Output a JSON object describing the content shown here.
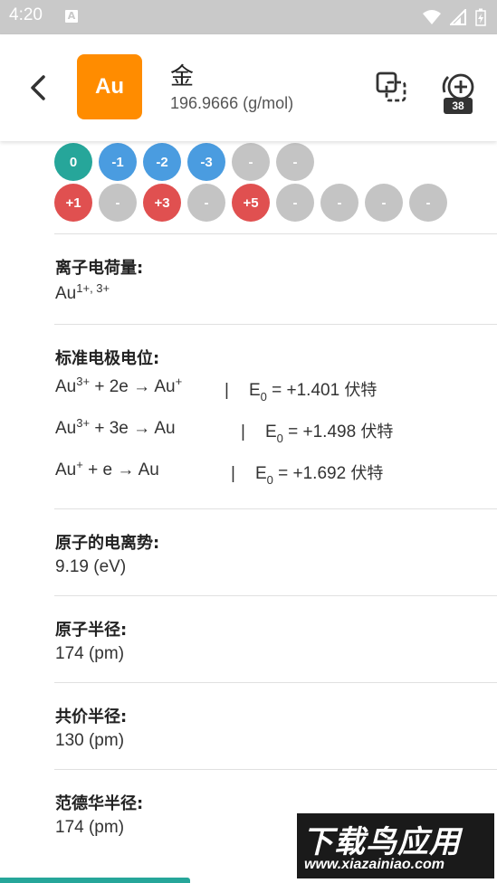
{
  "status_bar": {
    "time": "4:20",
    "notif_icon": "A"
  },
  "header": {
    "symbol": "Au",
    "name": "金",
    "molar_mass": "196.9666 (g/mol)",
    "counter": "38",
    "tile_color": "#ff8c00"
  },
  "oxidation_states": {
    "row1": [
      {
        "label": "0",
        "color": "#26a69a"
      },
      {
        "label": "-1",
        "color": "#4a9ce0"
      },
      {
        "label": "-2",
        "color": "#4a9ce0"
      },
      {
        "label": "-3",
        "color": "#4a9ce0"
      },
      {
        "label": "-",
        "color": "#c4c4c4"
      },
      {
        "label": "-",
        "color": "#c4c4c4"
      }
    ],
    "row2": [
      {
        "label": "+1",
        "color": "#e05050"
      },
      {
        "label": "-",
        "color": "#c4c4c4"
      },
      {
        "label": "+3",
        "color": "#e05050"
      },
      {
        "label": "-",
        "color": "#c4c4c4"
      },
      {
        "label": "+5",
        "color": "#e05050"
      },
      {
        "label": "-",
        "color": "#c4c4c4"
      },
      {
        "label": "-",
        "color": "#c4c4c4"
      },
      {
        "label": "-",
        "color": "#c4c4c4"
      },
      {
        "label": "-",
        "color": "#c4c4c4"
      }
    ]
  },
  "ion_charge": {
    "label": "离子电荷量:",
    "base": "Au",
    "sup": "1+, 3+"
  },
  "electrode": {
    "label": "标准电极电位:",
    "equations": [
      {
        "a": "Au",
        "a_sup": "3+",
        "mid": " + 2e → Au",
        "mid_sup": "+",
        "sep": "|",
        "e": "E",
        "e_sub": "0",
        "val": " = +1.401 ",
        "unit": "伏特"
      },
      {
        "a": "Au",
        "a_sup": "3+",
        "mid": " + 3e → Au",
        "mid_sup": "",
        "sep": "|",
        "e": "E",
        "e_sub": "0",
        "val": " = +1.498 ",
        "unit": "伏特"
      },
      {
        "a": "Au",
        "a_sup": "+",
        "mid": " + e → Au",
        "mid_sup": "",
        "sep": "|",
        "e": "E",
        "e_sub": "0",
        "val": " = +1.692 ",
        "unit": "伏特"
      }
    ]
  },
  "properties": [
    {
      "label": "原子的电离势:",
      "value": "9.19 (eV)"
    },
    {
      "label": "原子半径:",
      "value": "174 (pm)"
    },
    {
      "label": "共价半径:",
      "value": "130 (pm)"
    },
    {
      "label": "范德华半径:",
      "value": "174 (pm)"
    }
  ],
  "watermark": {
    "title": "下载鸟应用",
    "url": "www.xiazainiao.com"
  }
}
